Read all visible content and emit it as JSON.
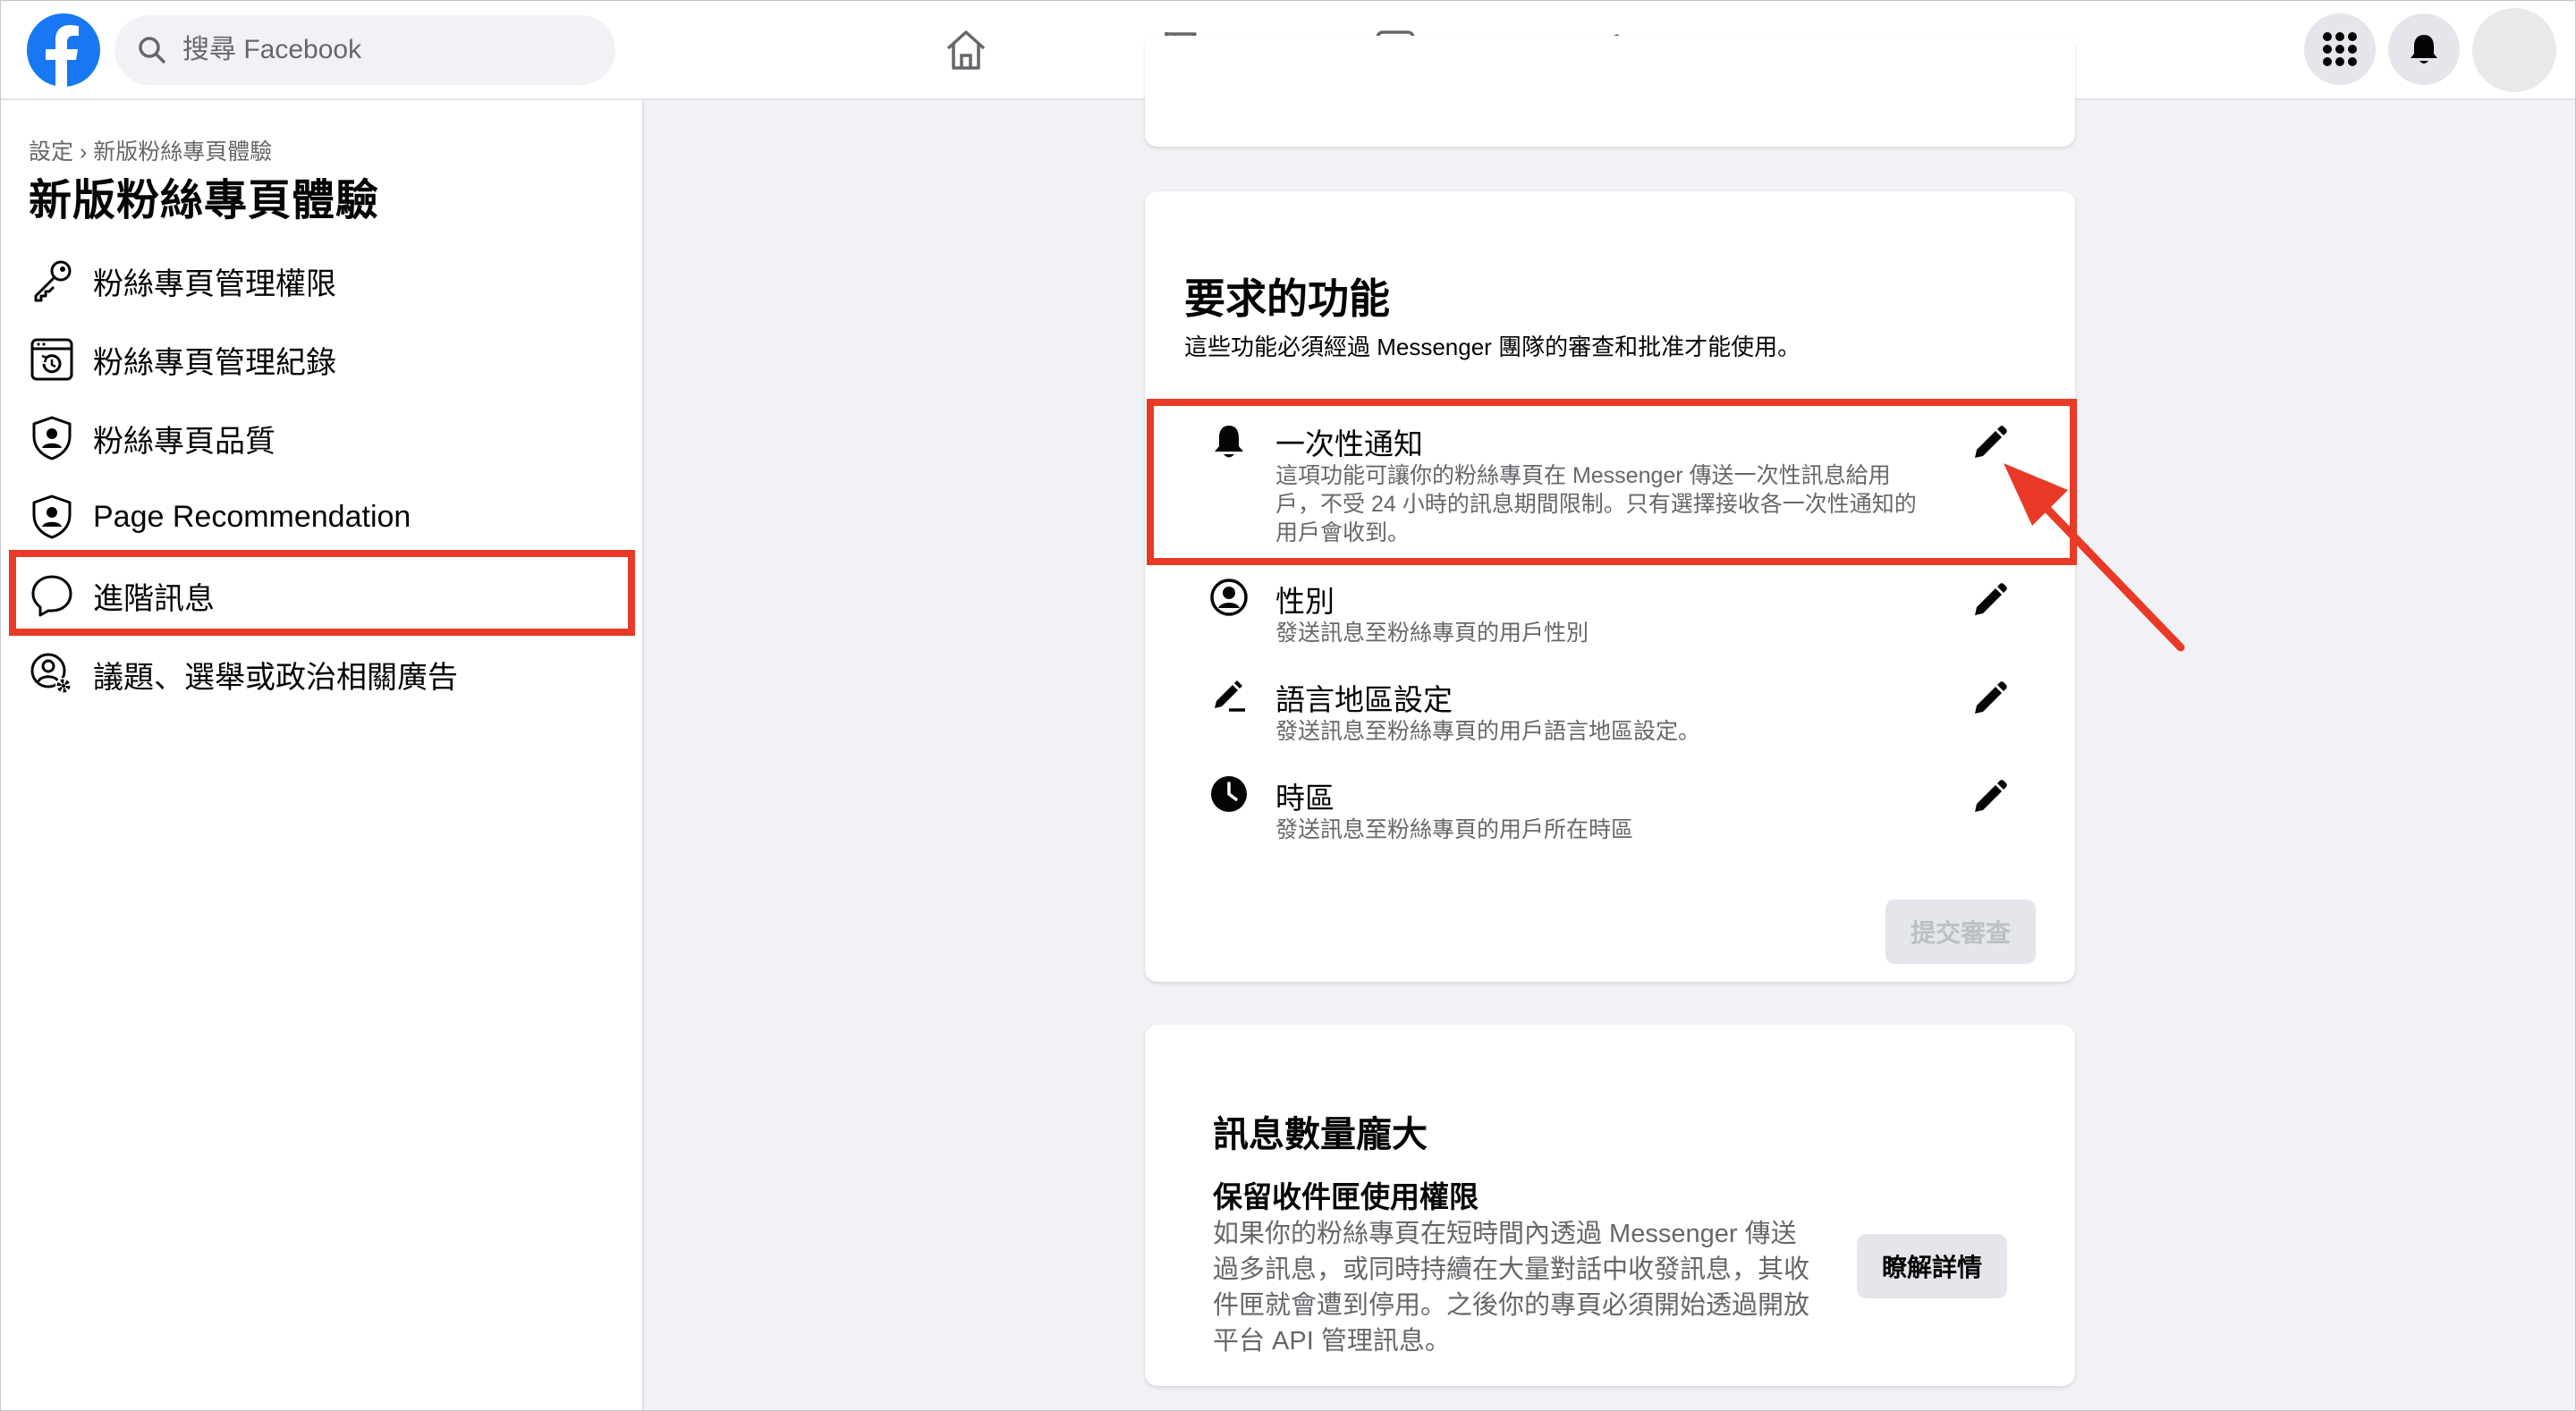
{
  "search": {
    "placeholder": "搜尋 Facebook"
  },
  "top_nav": {
    "icons": [
      "facebook-logo",
      "home-icon",
      "flag-icon",
      "insights-icon",
      "megaphone-icon",
      "menu-grid-icon",
      "notifications-bell-icon",
      "avatar"
    ]
  },
  "sidebar": {
    "breadcrumb": "設定 › 新版粉絲專頁體驗",
    "title": "新版粉絲專頁體驗",
    "items": [
      {
        "label": "粉絲專頁管理權限",
        "icon": "key-icon"
      },
      {
        "label": "粉絲專頁管理紀錄",
        "icon": "history-icon"
      },
      {
        "label": "粉絲專頁品質",
        "icon": "shield-user-icon"
      },
      {
        "label": "Page Recommendation",
        "icon": "shield-user-icon"
      },
      {
        "label": "進階訊息",
        "icon": "chat-bubble-icon"
      },
      {
        "label": "議題、選舉或政治相關廣告",
        "icon": "user-gear-icon"
      }
    ],
    "selected": "進階訊息"
  },
  "requested_features": {
    "title": "要求的功能",
    "subtitle": "這些功能必須經過 Messenger 團隊的審查和批准才能使用。",
    "features": [
      {
        "name": "一次性通知",
        "desc_line1": "這項功能可讓你的粉絲專頁在 Messenger 傳送一次性訊息給用",
        "desc_line2": "戶，不受 24 小時的訊息期間限制。只有選擇接收各一次性通知的",
        "desc_line3": "用戶會收到。",
        "icon": "bell-icon"
      },
      {
        "name": "性別",
        "desc": "發送訊息至粉絲專頁的用戶性別",
        "icon": "person-circle-icon"
      },
      {
        "name": "語言地區設定",
        "desc": "發送訊息至粉絲專頁的用戶語言地區設定。",
        "icon": "pencil-icon"
      },
      {
        "name": "時區",
        "desc": "發送訊息至粉絲專頁的用戶所在時區",
        "icon": "clock-icon"
      }
    ],
    "submit_label": "提交審查"
  },
  "high_volume": {
    "title": "訊息數量龐大",
    "subtitle": "保留收件匣使用權限",
    "desc_line1": "如果你的粉絲專頁在短時間內透過 Messenger 傳送",
    "desc_line2": "過多訊息，或同時持續在大量對話中收發訊息，其收",
    "desc_line3": "件匣就會遭到停用。之後你的專頁必須開始透過開放",
    "desc_line4": "平台 API 管理訊息。",
    "learn_more_label": "瞭解詳情"
  },
  "colors": {
    "brand": "#1877f2",
    "highlight": "#e83a27",
    "secondary_text": "#65676b",
    "background": "#f0f2f5"
  }
}
